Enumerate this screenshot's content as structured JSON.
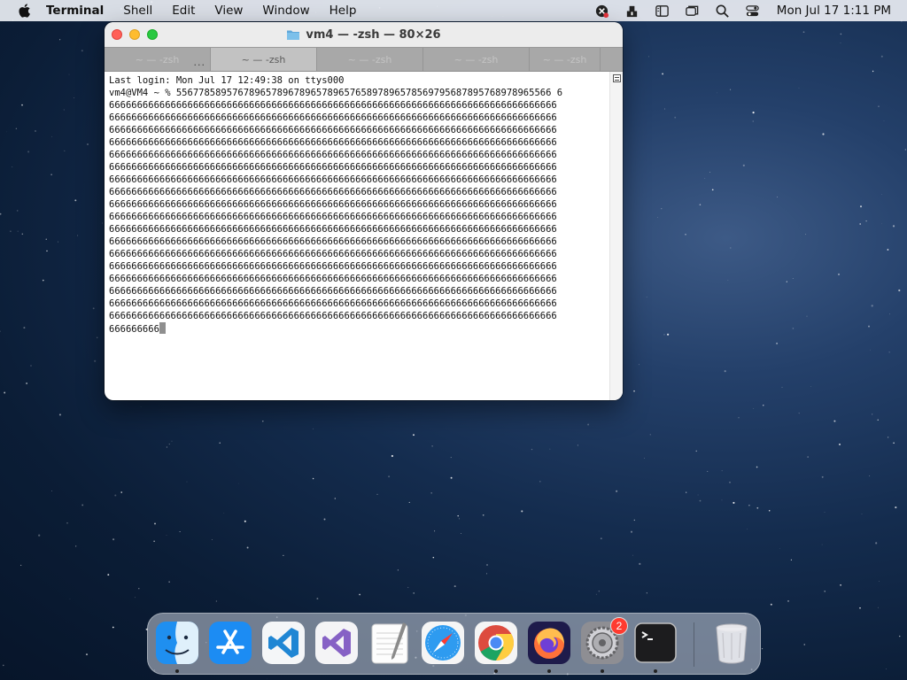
{
  "menubar": {
    "app_name": "Terminal",
    "items": [
      "Shell",
      "Edit",
      "View",
      "Window",
      "Help"
    ],
    "clock": "Mon Jul 17  1:11 PM"
  },
  "window": {
    "title": "vm4 — -zsh — 80×26",
    "tabs": [
      {
        "label": "~ — -zsh",
        "active": false
      },
      {
        "label": "~ — -zsh",
        "active": true
      },
      {
        "label": "~ — -zsh",
        "active": false
      },
      {
        "label": "~ — -zsh",
        "active": false
      },
      {
        "label": "~ — -zsh",
        "active": false
      }
    ],
    "tab_overflow": "...",
    "terminal": {
      "last_login": "Last login: Mon Jul 17 12:49:38 on ttys000",
      "prompt": "vm4@VM4 ~ % ",
      "first_line_input": "5567785895767896578967896578965765897896578569795687895768978965566 6",
      "repeated_line": "66666666666666666666666666666666666666666666666666666666666666666666666666666666",
      "repeated_count": 18,
      "last_line": "666666666"
    }
  },
  "dock": {
    "items": [
      {
        "name": "finder",
        "running": true
      },
      {
        "name": "app-store",
        "running": false
      },
      {
        "name": "visual-studio-code",
        "running": false
      },
      {
        "name": "visual-studio",
        "running": false
      },
      {
        "name": "textedit",
        "running": false
      },
      {
        "name": "safari",
        "running": false
      },
      {
        "name": "chrome",
        "running": true
      },
      {
        "name": "firefox",
        "running": true
      },
      {
        "name": "system-preferences",
        "running": true,
        "badge": "2"
      },
      {
        "name": "terminal",
        "running": true
      },
      {
        "name": "trash",
        "running": false
      }
    ]
  }
}
